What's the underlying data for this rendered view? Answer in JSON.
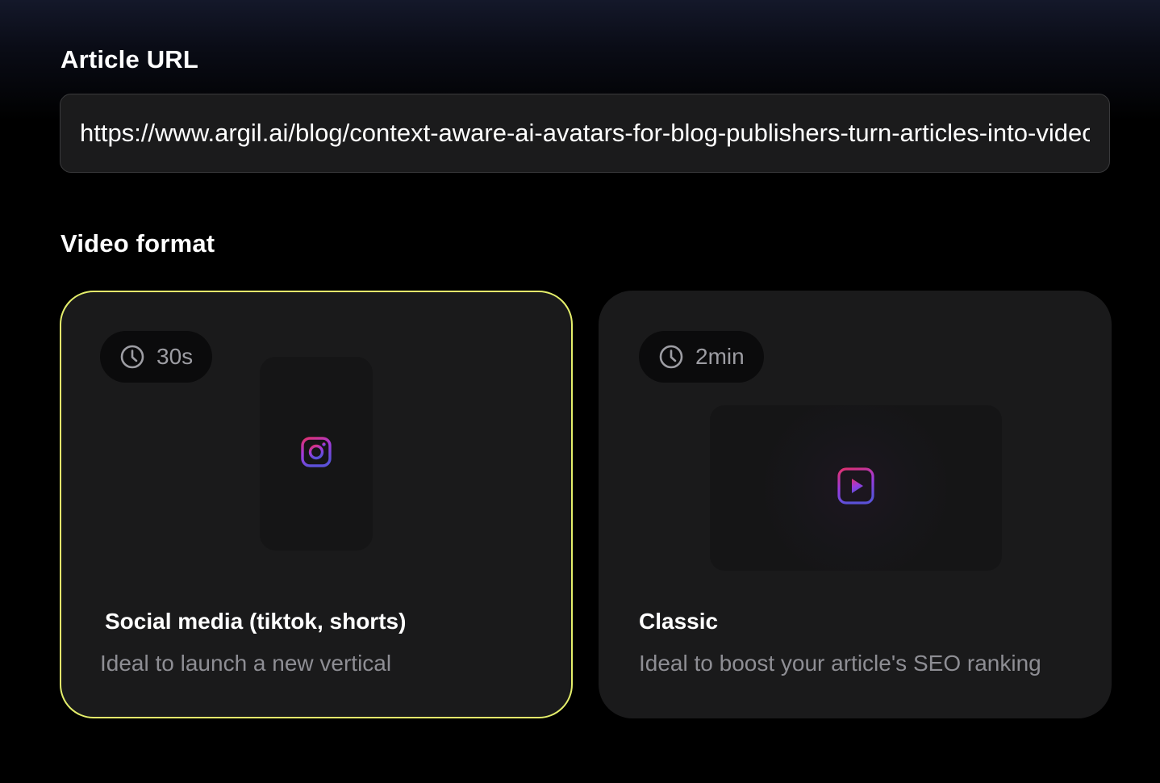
{
  "article_url": {
    "label": "Article URL",
    "value": "https://www.argil.ai/blog/context-aware-ai-avatars-for-blog-publishers-turn-articles-into-videos",
    "placeholder": ""
  },
  "video_format": {
    "label": "Video format",
    "selected": "social",
    "options": [
      {
        "id": "social",
        "duration": "30s",
        "title": "Social media (tiktok, shorts)",
        "description": "Ideal to launch a new vertical",
        "icon": "instagram-icon"
      },
      {
        "id": "classic",
        "duration": "2min",
        "title": "Classic",
        "description": "Ideal to boost your article's SEO ranking",
        "icon": "play-icon"
      }
    ]
  },
  "colors": {
    "selected_border": "#e5ef6b",
    "card_background": "#1a1a1b",
    "icon_gradient_start": "#e1306c",
    "icon_gradient_end": "#5b51d8"
  }
}
